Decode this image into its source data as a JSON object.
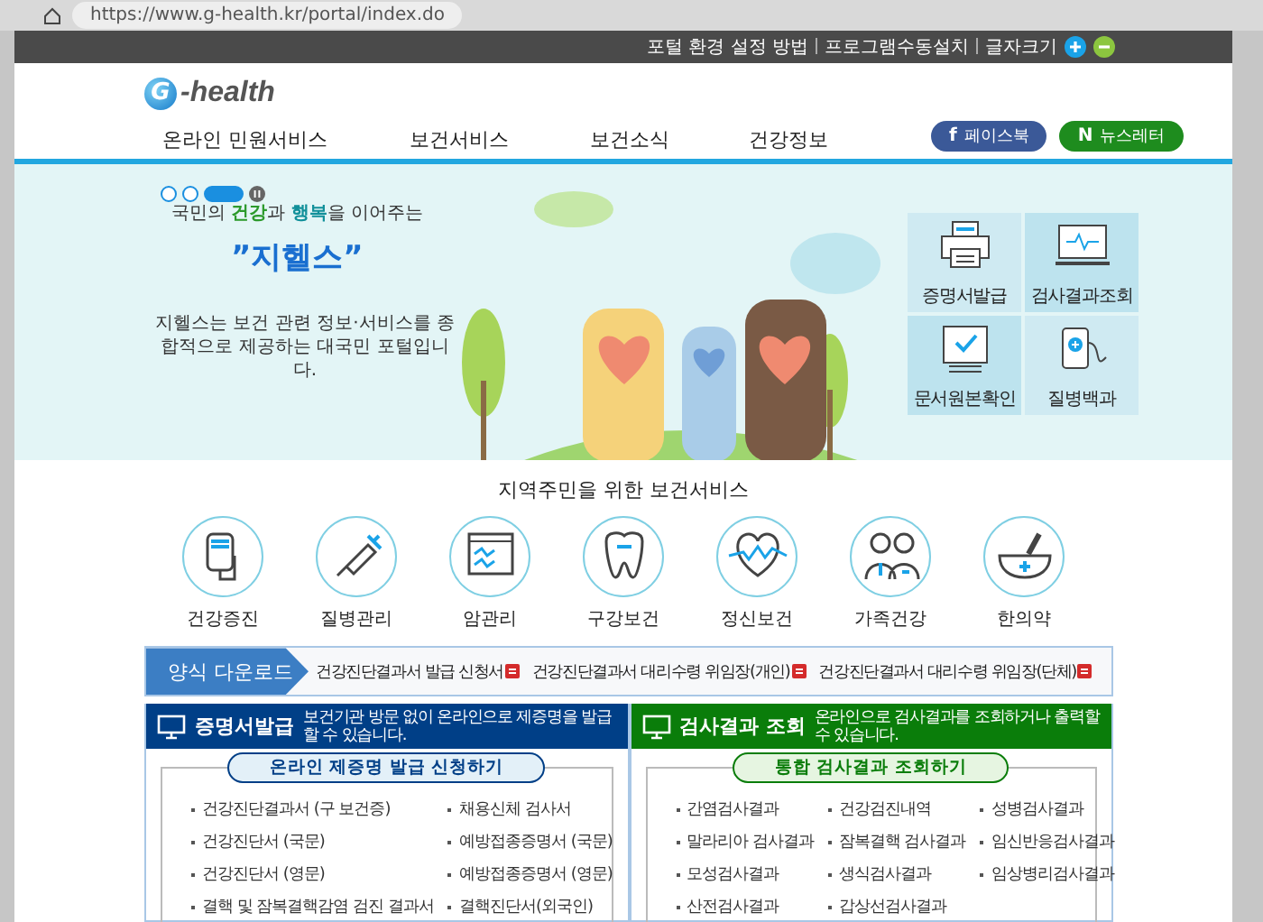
{
  "browser": {
    "url": "https://www.g-health.kr/portal/index.do"
  },
  "top_bar": {
    "links": [
      "포털 환경 설정 방법",
      "프로그램수동설치",
      "글자크기"
    ]
  },
  "header": {
    "logo_mark": "G",
    "logo_text": "-health",
    "nav": [
      "온라인 민원서비스",
      "보건서비스",
      "보건소식",
      "건강정보"
    ],
    "social": [
      {
        "kind": "facebook",
        "mark": "f",
        "label": "페이스북"
      },
      {
        "kind": "newsletter",
        "mark": "N",
        "label": "뉴스레터"
      }
    ]
  },
  "banner": {
    "slides": [
      {
        "selected": false
      },
      {
        "selected": false
      },
      {
        "selected": true
      }
    ],
    "tagline": "국민의 **건강**과 **행복**을 이어주는",
    "title": "”지헬스”",
    "description": "지헬스는 보건 관련 정보·서비스를 종합적으로 제공하는 대국민 포털입니다.",
    "quick_links": [
      {
        "kind": "printer",
        "label": "증명서발급"
      },
      {
        "kind": "monitor",
        "label": "검사결과조회"
      },
      {
        "kind": "document",
        "label": "문서원본확인"
      },
      {
        "kind": "clipboard",
        "label": "질병백과"
      }
    ]
  },
  "services": {
    "title": "지역주민을 위한 보건서비스",
    "items": [
      {
        "kind": "iv",
        "label": "건강증진"
      },
      {
        "kind": "syringe",
        "label": "질병관리"
      },
      {
        "kind": "chart",
        "label": "암관리"
      },
      {
        "kind": "tooth",
        "label": "구강보건"
      },
      {
        "kind": "heart",
        "label": "정신보건"
      },
      {
        "kind": "family",
        "label": "가족건강"
      },
      {
        "kind": "mortar",
        "label": "한의약"
      }
    ]
  },
  "downloads": {
    "title": "양식 다운로드",
    "items": [
      "건강진단결과서 발급 신청서",
      "건강진단결과서 대리수령 위임장(개인)",
      "건강진단결과서 대리수령 위임장(단체)"
    ]
  },
  "panels": [
    {
      "color": "#003f87",
      "title": "증명서발급",
      "description": "보건기관 방문 없이 온라인으로 제증명을 발급할 수 있습니다.",
      "button": "온라인 제증명 발급 신청하기",
      "items": [
        "건강진단결과서 (구 보건증)",
        "채용신체 검사서",
        "건강진단서 (국문)",
        "예방접종증명서 (국문)",
        "건강진단서 (영문)",
        "예방접종증명서 (영문)",
        "결핵 및 잠복결핵감염 검진 결과서",
        "결핵진단서(외국인)"
      ]
    },
    {
      "color": "#0a7d0a",
      "title": "검사결과 조회",
      "description": "온라인으로 검사결과를 조회하거나 출력할 수 있습니다.",
      "button": "통합 검사결과 조회하기",
      "items": [
        "간염검사결과",
        "건강검진내역",
        "성병검사결과",
        "말라리아 검사결과",
        "잠복결핵 검사결과",
        "임신반응검사결과",
        "모성검사결과",
        "생식검사결과",
        "임상병리검사결과",
        "산전검사결과",
        "갑상선검사결과"
      ]
    }
  ]
}
